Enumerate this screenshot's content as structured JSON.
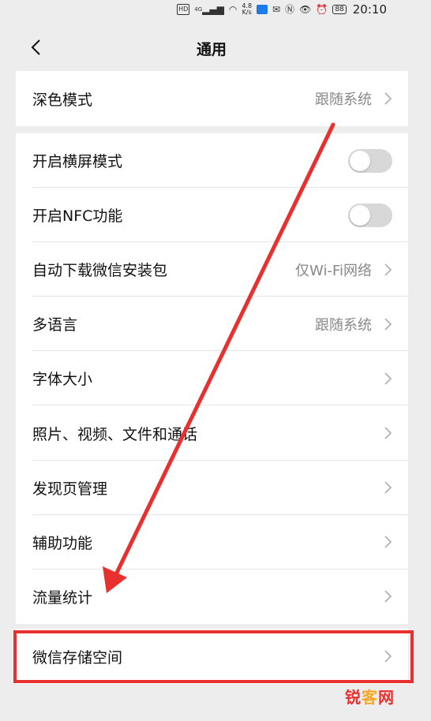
{
  "status_bar": {
    "hd": "HD",
    "network": "4G",
    "speed_top": "4.8",
    "speed_bottom": "K/s",
    "battery": "88",
    "time": "20:10"
  },
  "nav": {
    "title": "通用"
  },
  "sections": [
    {
      "rows": [
        {
          "label": "深色模式",
          "value": "跟随系统"
        }
      ]
    },
    {
      "rows": [
        {
          "label": "开启横屏模式",
          "toggle": false
        },
        {
          "label": "开启NFC功能",
          "toggle": false
        },
        {
          "label": "自动下载微信安装包",
          "value": "仅Wi-Fi网络"
        },
        {
          "label": "多语言",
          "value": "跟随系统"
        },
        {
          "label": "字体大小"
        },
        {
          "label": "照片、视频、文件和通话"
        },
        {
          "label": "发现页管理"
        },
        {
          "label": "辅助功能"
        },
        {
          "label": "流量统计"
        }
      ]
    },
    {
      "rows": [
        {
          "label": "微信存储空间"
        }
      ]
    }
  ],
  "watermark": {
    "part1": "锐",
    "part2": "客",
    "part3": "网"
  },
  "colors": {
    "annotation_red": "#e8302f",
    "background": "#ededed",
    "toggle_off": "#d8d8d8"
  }
}
